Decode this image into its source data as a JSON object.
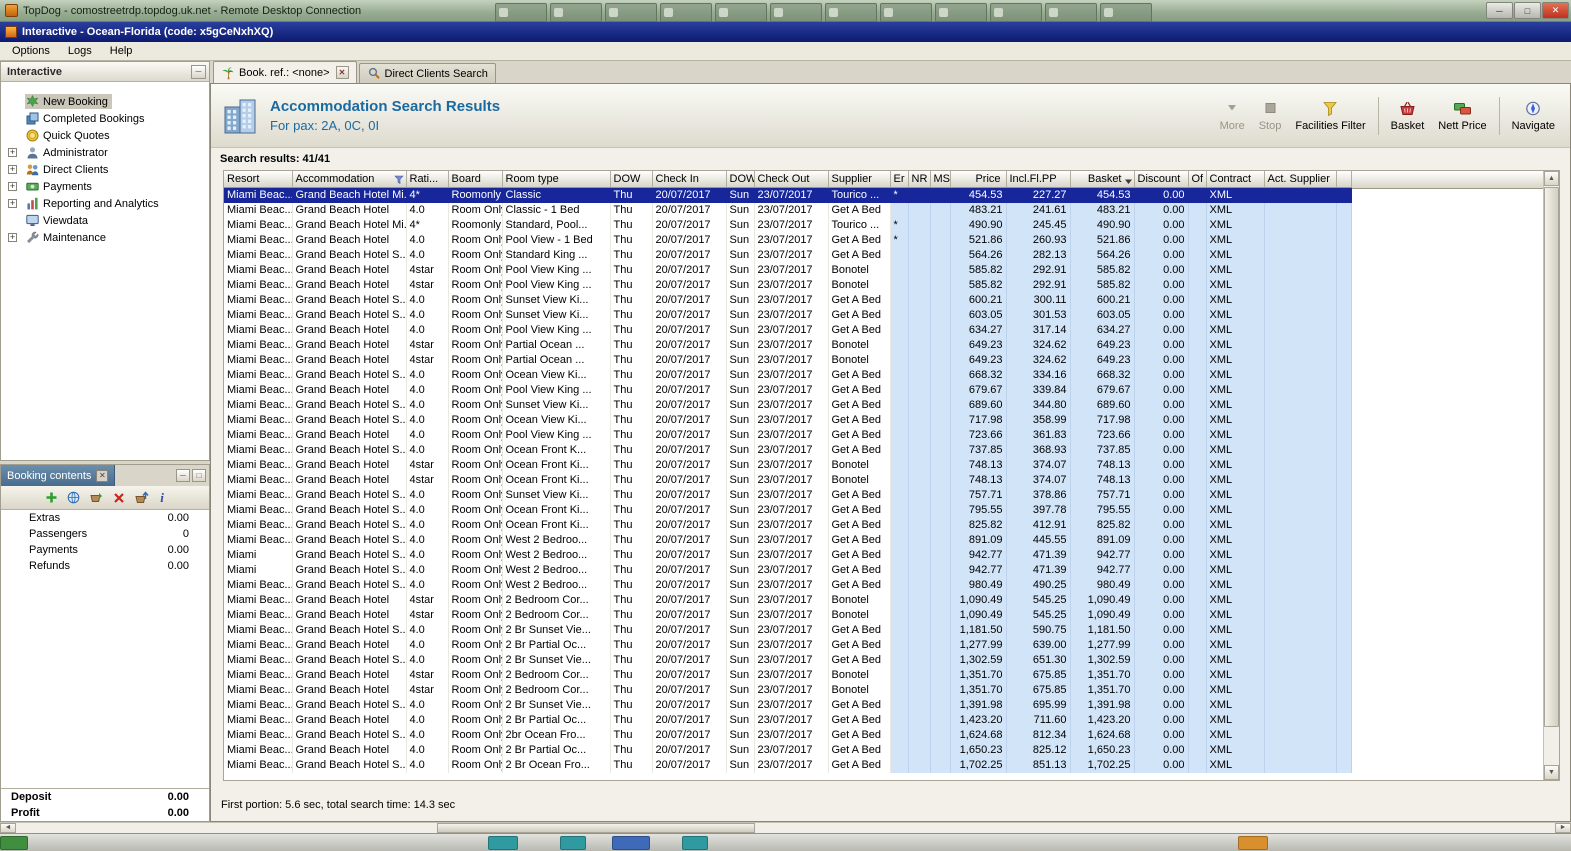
{
  "rdp": {
    "title": "TopDog - comostreetrdp.topdog.uk.net - Remote Desktop Connection"
  },
  "window": {
    "title": "Interactive - Ocean-Florida (code: x5gCeNxhXQ)"
  },
  "menu": [
    "Options",
    "Logs",
    "Help"
  ],
  "sidebar": {
    "title": "Interactive",
    "items": [
      {
        "label": "New Booking",
        "icon": "new-booking-icon",
        "selected": true
      },
      {
        "label": "Completed Bookings",
        "icon": "completed-bookings-icon"
      },
      {
        "label": "Quick Quotes",
        "icon": "quick-quotes-icon"
      },
      {
        "label": "Administrator",
        "icon": "administrator-icon",
        "expandable": true
      },
      {
        "label": "Direct Clients",
        "icon": "direct-clients-icon",
        "expandable": true
      },
      {
        "label": "Payments",
        "icon": "payments-icon",
        "expandable": true
      },
      {
        "label": "Reporting and Analytics",
        "icon": "reporting-icon",
        "expandable": true
      },
      {
        "label": "Viewdata",
        "icon": "viewdata-icon"
      },
      {
        "label": "Maintenance",
        "icon": "maintenance-icon",
        "expandable": true
      }
    ]
  },
  "booking_contents": {
    "title": "Booking contents",
    "toolbar": [
      "add-icon",
      "globe-icon",
      "basket-add-icon",
      "delete-icon",
      "basket-up-icon",
      "info-icon"
    ],
    "rows": [
      {
        "label": "Extras",
        "value": "0.00"
      },
      {
        "label": "Passengers",
        "value": "0"
      },
      {
        "label": "Payments",
        "value": "0.00"
      },
      {
        "label": "Refunds",
        "value": "0.00"
      }
    ],
    "summary": [
      {
        "label": "Deposit",
        "value": "0.00"
      },
      {
        "label": "Profit",
        "value": "0.00"
      }
    ]
  },
  "tabs": [
    {
      "label": "Book. ref.: <none>",
      "icon": "palm-icon",
      "active": true,
      "closable": true
    },
    {
      "label": "Direct Clients Search",
      "icon": "clients-search-icon"
    }
  ],
  "header": {
    "title": "Accommodation Search Results",
    "subtitle": "For pax: 2A, 0C, 0I"
  },
  "toolbar": [
    {
      "label": "More",
      "icon": "more-icon",
      "enabled": false
    },
    {
      "label": "Stop",
      "icon": "stop-icon",
      "enabled": false
    },
    {
      "label": "Facilities Filter",
      "icon": "facilities-filter-icon",
      "enabled": true,
      "sep_after": true
    },
    {
      "label": "Basket",
      "icon": "basket-icon",
      "enabled": true
    },
    {
      "label": "Nett Price",
      "icon": "nett-price-icon",
      "enabled": true,
      "sep_after": true
    },
    {
      "label": "Navigate",
      "icon": "navigate-icon",
      "enabled": true
    }
  ],
  "results_count": "Search results: 41/41",
  "table": {
    "columns": [
      "Resort",
      "Accommodation",
      "Rati...",
      "Board",
      "Room type",
      "DOW",
      "Check In",
      "DOW",
      "Check Out",
      "Supplier",
      "Er",
      "NR",
      "MS",
      "Price",
      "Incl.Fl.PP",
      "Basket",
      "Discount",
      "Of",
      "Contract",
      "Act. Supplier"
    ],
    "filter_icon_column": 1,
    "sort_icon_column": 15,
    "selected_row_index": 0,
    "rows": [
      [
        "Miami Beac...",
        "Grand Beach Hotel Mi...",
        "4*",
        "Roomonly",
        "Classic",
        "Thu",
        "20/07/2017",
        "Sun",
        "23/07/2017",
        "Tourico ...",
        "*",
        "",
        "",
        "454.53",
        "227.27",
        "454.53",
        "0.00",
        "",
        "XML",
        ""
      ],
      [
        "Miami Beac...",
        "Grand Beach Hotel",
        "4.0",
        "Room Only",
        "Classic - 1 Bed",
        "Thu",
        "20/07/2017",
        "Sun",
        "23/07/2017",
        "Get A Bed",
        "",
        "",
        "",
        "483.21",
        "241.61",
        "483.21",
        "0.00",
        "",
        "XML",
        ""
      ],
      [
        "Miami Beac...",
        "Grand Beach Hotel Mi...",
        "4*",
        "Roomonly",
        "Standard, Pool...",
        "Thu",
        "20/07/2017",
        "Sun",
        "23/07/2017",
        "Tourico ...",
        "*",
        "",
        "",
        "490.90",
        "245.45",
        "490.90",
        "0.00",
        "",
        "XML",
        ""
      ],
      [
        "Miami Beac...",
        "Grand Beach Hotel",
        "4.0",
        "Room Only",
        "Pool View - 1 Bed",
        "Thu",
        "20/07/2017",
        "Sun",
        "23/07/2017",
        "Get A Bed",
        "*",
        "",
        "",
        "521.86",
        "260.93",
        "521.86",
        "0.00",
        "",
        "XML",
        ""
      ],
      [
        "Miami Beac...",
        "Grand Beach Hotel S...",
        "4.0",
        "Room Only",
        "Standard King ...",
        "Thu",
        "20/07/2017",
        "Sun",
        "23/07/2017",
        "Get A Bed",
        "",
        "",
        "",
        "564.26",
        "282.13",
        "564.26",
        "0.00",
        "",
        "XML",
        ""
      ],
      [
        "Miami Beac...",
        "Grand Beach Hotel",
        "4star",
        "Room Only",
        "Pool View King ...",
        "Thu",
        "20/07/2017",
        "Sun",
        "23/07/2017",
        "Bonotel",
        "",
        "",
        "",
        "585.82",
        "292.91",
        "585.82",
        "0.00",
        "",
        "XML",
        ""
      ],
      [
        "Miami Beac...",
        "Grand Beach Hotel",
        "4star",
        "Room Only",
        "Pool View King ...",
        "Thu",
        "20/07/2017",
        "Sun",
        "23/07/2017",
        "Bonotel",
        "",
        "",
        "",
        "585.82",
        "292.91",
        "585.82",
        "0.00",
        "",
        "XML",
        ""
      ],
      [
        "Miami Beac...",
        "Grand Beach Hotel S...",
        "4.0",
        "Room Only",
        "Sunset View Ki...",
        "Thu",
        "20/07/2017",
        "Sun",
        "23/07/2017",
        "Get A Bed",
        "",
        "",
        "",
        "600.21",
        "300.11",
        "600.21",
        "0.00",
        "",
        "XML",
        ""
      ],
      [
        "Miami Beac...",
        "Grand Beach Hotel S...",
        "4.0",
        "Room Only",
        "Sunset View Ki...",
        "Thu",
        "20/07/2017",
        "Sun",
        "23/07/2017",
        "Get A Bed",
        "",
        "",
        "",
        "603.05",
        "301.53",
        "603.05",
        "0.00",
        "",
        "XML",
        ""
      ],
      [
        "Miami Beac...",
        "Grand Beach Hotel",
        "4.0",
        "Room Only",
        "Pool View King ...",
        "Thu",
        "20/07/2017",
        "Sun",
        "23/07/2017",
        "Get A Bed",
        "",
        "",
        "",
        "634.27",
        "317.14",
        "634.27",
        "0.00",
        "",
        "XML",
        ""
      ],
      [
        "Miami Beac...",
        "Grand Beach Hotel",
        "4star",
        "Room Only",
        "Partial Ocean ...",
        "Thu",
        "20/07/2017",
        "Sun",
        "23/07/2017",
        "Bonotel",
        "",
        "",
        "",
        "649.23",
        "324.62",
        "649.23",
        "0.00",
        "",
        "XML",
        ""
      ],
      [
        "Miami Beac...",
        "Grand Beach Hotel",
        "4star",
        "Room Only",
        "Partial Ocean ...",
        "Thu",
        "20/07/2017",
        "Sun",
        "23/07/2017",
        "Bonotel",
        "",
        "",
        "",
        "649.23",
        "324.62",
        "649.23",
        "0.00",
        "",
        "XML",
        ""
      ],
      [
        "Miami Beac...",
        "Grand Beach Hotel S...",
        "4.0",
        "Room Only",
        "Ocean View Ki...",
        "Thu",
        "20/07/2017",
        "Sun",
        "23/07/2017",
        "Get A Bed",
        "",
        "",
        "",
        "668.32",
        "334.16",
        "668.32",
        "0.00",
        "",
        "XML",
        ""
      ],
      [
        "Miami Beac...",
        "Grand Beach Hotel",
        "4.0",
        "Room Only",
        "Pool View King ...",
        "Thu",
        "20/07/2017",
        "Sun",
        "23/07/2017",
        "Get A Bed",
        "",
        "",
        "",
        "679.67",
        "339.84",
        "679.67",
        "0.00",
        "",
        "XML",
        ""
      ],
      [
        "Miami Beac...",
        "Grand Beach Hotel S...",
        "4.0",
        "Room Only",
        "Sunset View Ki...",
        "Thu",
        "20/07/2017",
        "Sun",
        "23/07/2017",
        "Get A Bed",
        "",
        "",
        "",
        "689.60",
        "344.80",
        "689.60",
        "0.00",
        "",
        "XML",
        ""
      ],
      [
        "Miami Beac...",
        "Grand Beach Hotel S...",
        "4.0",
        "Room Only",
        "Ocean View Ki...",
        "Thu",
        "20/07/2017",
        "Sun",
        "23/07/2017",
        "Get A Bed",
        "",
        "",
        "",
        "717.98",
        "358.99",
        "717.98",
        "0.00",
        "",
        "XML",
        ""
      ],
      [
        "Miami Beac...",
        "Grand Beach Hotel",
        "4.0",
        "Room Only",
        "Pool View King ...",
        "Thu",
        "20/07/2017",
        "Sun",
        "23/07/2017",
        "Get A Bed",
        "",
        "",
        "",
        "723.66",
        "361.83",
        "723.66",
        "0.00",
        "",
        "XML",
        ""
      ],
      [
        "Miami Beac...",
        "Grand Beach Hotel S...",
        "4.0",
        "Room Only",
        "Ocean Front K...",
        "Thu",
        "20/07/2017",
        "Sun",
        "23/07/2017",
        "Get A Bed",
        "",
        "",
        "",
        "737.85",
        "368.93",
        "737.85",
        "0.00",
        "",
        "XML",
        ""
      ],
      [
        "Miami Beac...",
        "Grand Beach Hotel",
        "4star",
        "Room Only",
        "Ocean Front Ki...",
        "Thu",
        "20/07/2017",
        "Sun",
        "23/07/2017",
        "Bonotel",
        "",
        "",
        "",
        "748.13",
        "374.07",
        "748.13",
        "0.00",
        "",
        "XML",
        ""
      ],
      [
        "Miami Beac...",
        "Grand Beach Hotel",
        "4star",
        "Room Only",
        "Ocean Front Ki...",
        "Thu",
        "20/07/2017",
        "Sun",
        "23/07/2017",
        "Bonotel",
        "",
        "",
        "",
        "748.13",
        "374.07",
        "748.13",
        "0.00",
        "",
        "XML",
        ""
      ],
      [
        "Miami Beac...",
        "Grand Beach Hotel S...",
        "4.0",
        "Room Only",
        "Sunset View Ki...",
        "Thu",
        "20/07/2017",
        "Sun",
        "23/07/2017",
        "Get A Bed",
        "",
        "",
        "",
        "757.71",
        "378.86",
        "757.71",
        "0.00",
        "",
        "XML",
        ""
      ],
      [
        "Miami Beac...",
        "Grand Beach Hotel S...",
        "4.0",
        "Room Only",
        "Ocean Front Ki...",
        "Thu",
        "20/07/2017",
        "Sun",
        "23/07/2017",
        "Get A Bed",
        "",
        "",
        "",
        "795.55",
        "397.78",
        "795.55",
        "0.00",
        "",
        "XML",
        ""
      ],
      [
        "Miami Beac...",
        "Grand Beach Hotel S...",
        "4.0",
        "Room Only",
        "Ocean Front Ki...",
        "Thu",
        "20/07/2017",
        "Sun",
        "23/07/2017",
        "Get A Bed",
        "",
        "",
        "",
        "825.82",
        "412.91",
        "825.82",
        "0.00",
        "",
        "XML",
        ""
      ],
      [
        "Miami Beac...",
        "Grand Beach Hotel S...",
        "4.0",
        "Room Only",
        "West 2 Bedroo...",
        "Thu",
        "20/07/2017",
        "Sun",
        "23/07/2017",
        "Get A Bed",
        "",
        "",
        "",
        "891.09",
        "445.55",
        "891.09",
        "0.00",
        "",
        "XML",
        ""
      ],
      [
        "Miami",
        "Grand Beach Hotel S...",
        "4.0",
        "Room Only",
        "West 2 Bedroo...",
        "Thu",
        "20/07/2017",
        "Sun",
        "23/07/2017",
        "Get A Bed",
        "",
        "",
        "",
        "942.77",
        "471.39",
        "942.77",
        "0.00",
        "",
        "XML",
        ""
      ],
      [
        "Miami",
        "Grand Beach Hotel S...",
        "4.0",
        "Room Only",
        "West 2 Bedroo...",
        "Thu",
        "20/07/2017",
        "Sun",
        "23/07/2017",
        "Get A Bed",
        "",
        "",
        "",
        "942.77",
        "471.39",
        "942.77",
        "0.00",
        "",
        "XML",
        ""
      ],
      [
        "Miami Beac...",
        "Grand Beach Hotel S...",
        "4.0",
        "Room Only",
        "West 2 Bedroo...",
        "Thu",
        "20/07/2017",
        "Sun",
        "23/07/2017",
        "Get A Bed",
        "",
        "",
        "",
        "980.49",
        "490.25",
        "980.49",
        "0.00",
        "",
        "XML",
        ""
      ],
      [
        "Miami Beac...",
        "Grand Beach Hotel",
        "4star",
        "Room Only",
        "2 Bedroom Cor...",
        "Thu",
        "20/07/2017",
        "Sun",
        "23/07/2017",
        "Bonotel",
        "",
        "",
        "",
        "1,090.49",
        "545.25",
        "1,090.49",
        "0.00",
        "",
        "XML",
        ""
      ],
      [
        "Miami Beac...",
        "Grand Beach Hotel",
        "4star",
        "Room Only",
        "2 Bedroom Cor...",
        "Thu",
        "20/07/2017",
        "Sun",
        "23/07/2017",
        "Bonotel",
        "",
        "",
        "",
        "1,090.49",
        "545.25",
        "1,090.49",
        "0.00",
        "",
        "XML",
        ""
      ],
      [
        "Miami Beac...",
        "Grand Beach Hotel S...",
        "4.0",
        "Room Only",
        "2 Br Sunset Vie...",
        "Thu",
        "20/07/2017",
        "Sun",
        "23/07/2017",
        "Get A Bed",
        "",
        "",
        "",
        "1,181.50",
        "590.75",
        "1,181.50",
        "0.00",
        "",
        "XML",
        ""
      ],
      [
        "Miami Beac...",
        "Grand Beach Hotel",
        "4.0",
        "Room Only",
        "2 Br Partial Oc...",
        "Thu",
        "20/07/2017",
        "Sun",
        "23/07/2017",
        "Get A Bed",
        "",
        "",
        "",
        "1,277.99",
        "639.00",
        "1,277.99",
        "0.00",
        "",
        "XML",
        ""
      ],
      [
        "Miami Beac...",
        "Grand Beach Hotel S...",
        "4.0",
        "Room Only",
        "2 Br Sunset Vie...",
        "Thu",
        "20/07/2017",
        "Sun",
        "23/07/2017",
        "Get A Bed",
        "",
        "",
        "",
        "1,302.59",
        "651.30",
        "1,302.59",
        "0.00",
        "",
        "XML",
        ""
      ],
      [
        "Miami Beac...",
        "Grand Beach Hotel",
        "4star",
        "Room Only",
        "2 Bedroom Cor...",
        "Thu",
        "20/07/2017",
        "Sun",
        "23/07/2017",
        "Bonotel",
        "",
        "",
        "",
        "1,351.70",
        "675.85",
        "1,351.70",
        "0.00",
        "",
        "XML",
        ""
      ],
      [
        "Miami Beac...",
        "Grand Beach Hotel",
        "4star",
        "Room Only",
        "2 Bedroom Cor...",
        "Thu",
        "20/07/2017",
        "Sun",
        "23/07/2017",
        "Bonotel",
        "",
        "",
        "",
        "1,351.70",
        "675.85",
        "1,351.70",
        "0.00",
        "",
        "XML",
        ""
      ],
      [
        "Miami Beac...",
        "Grand Beach Hotel S...",
        "4.0",
        "Room Only",
        "2 Br Sunset Vie...",
        "Thu",
        "20/07/2017",
        "Sun",
        "23/07/2017",
        "Get A Bed",
        "",
        "",
        "",
        "1,391.98",
        "695.99",
        "1,391.98",
        "0.00",
        "",
        "XML",
        ""
      ],
      [
        "Miami Beac...",
        "Grand Beach Hotel",
        "4.0",
        "Room Only",
        "2 Br Partial Oc...",
        "Thu",
        "20/07/2017",
        "Sun",
        "23/07/2017",
        "Get A Bed",
        "",
        "",
        "",
        "1,423.20",
        "711.60",
        "1,423.20",
        "0.00",
        "",
        "XML",
        ""
      ],
      [
        "Miami Beac...",
        "Grand Beach Hotel S...",
        "4.0",
        "Room Only",
        "2br Ocean Fro...",
        "Thu",
        "20/07/2017",
        "Sun",
        "23/07/2017",
        "Get A Bed",
        "",
        "",
        "",
        "1,624.68",
        "812.34",
        "1,624.68",
        "0.00",
        "",
        "XML",
        ""
      ],
      [
        "Miami Beac...",
        "Grand Beach Hotel",
        "4.0",
        "Room Only",
        "2 Br Partial Oc...",
        "Thu",
        "20/07/2017",
        "Sun",
        "23/07/2017",
        "Get A Bed",
        "",
        "",
        "",
        "1,650.23",
        "825.12",
        "1,650.23",
        "0.00",
        "",
        "XML",
        ""
      ],
      [
        "Miami Beac...",
        "Grand Beach Hotel S...",
        "4.0",
        "Room Only",
        "2 Br Ocean Fro...",
        "Thu",
        "20/07/2017",
        "Sun",
        "23/07/2017",
        "Get A Bed",
        "",
        "",
        "",
        "1,702.25",
        "851.13",
        "1,702.25",
        "0.00",
        "",
        "XML",
        ""
      ]
    ]
  },
  "status": "First portion: 5.6 sec, total search time: 14.3 sec"
}
